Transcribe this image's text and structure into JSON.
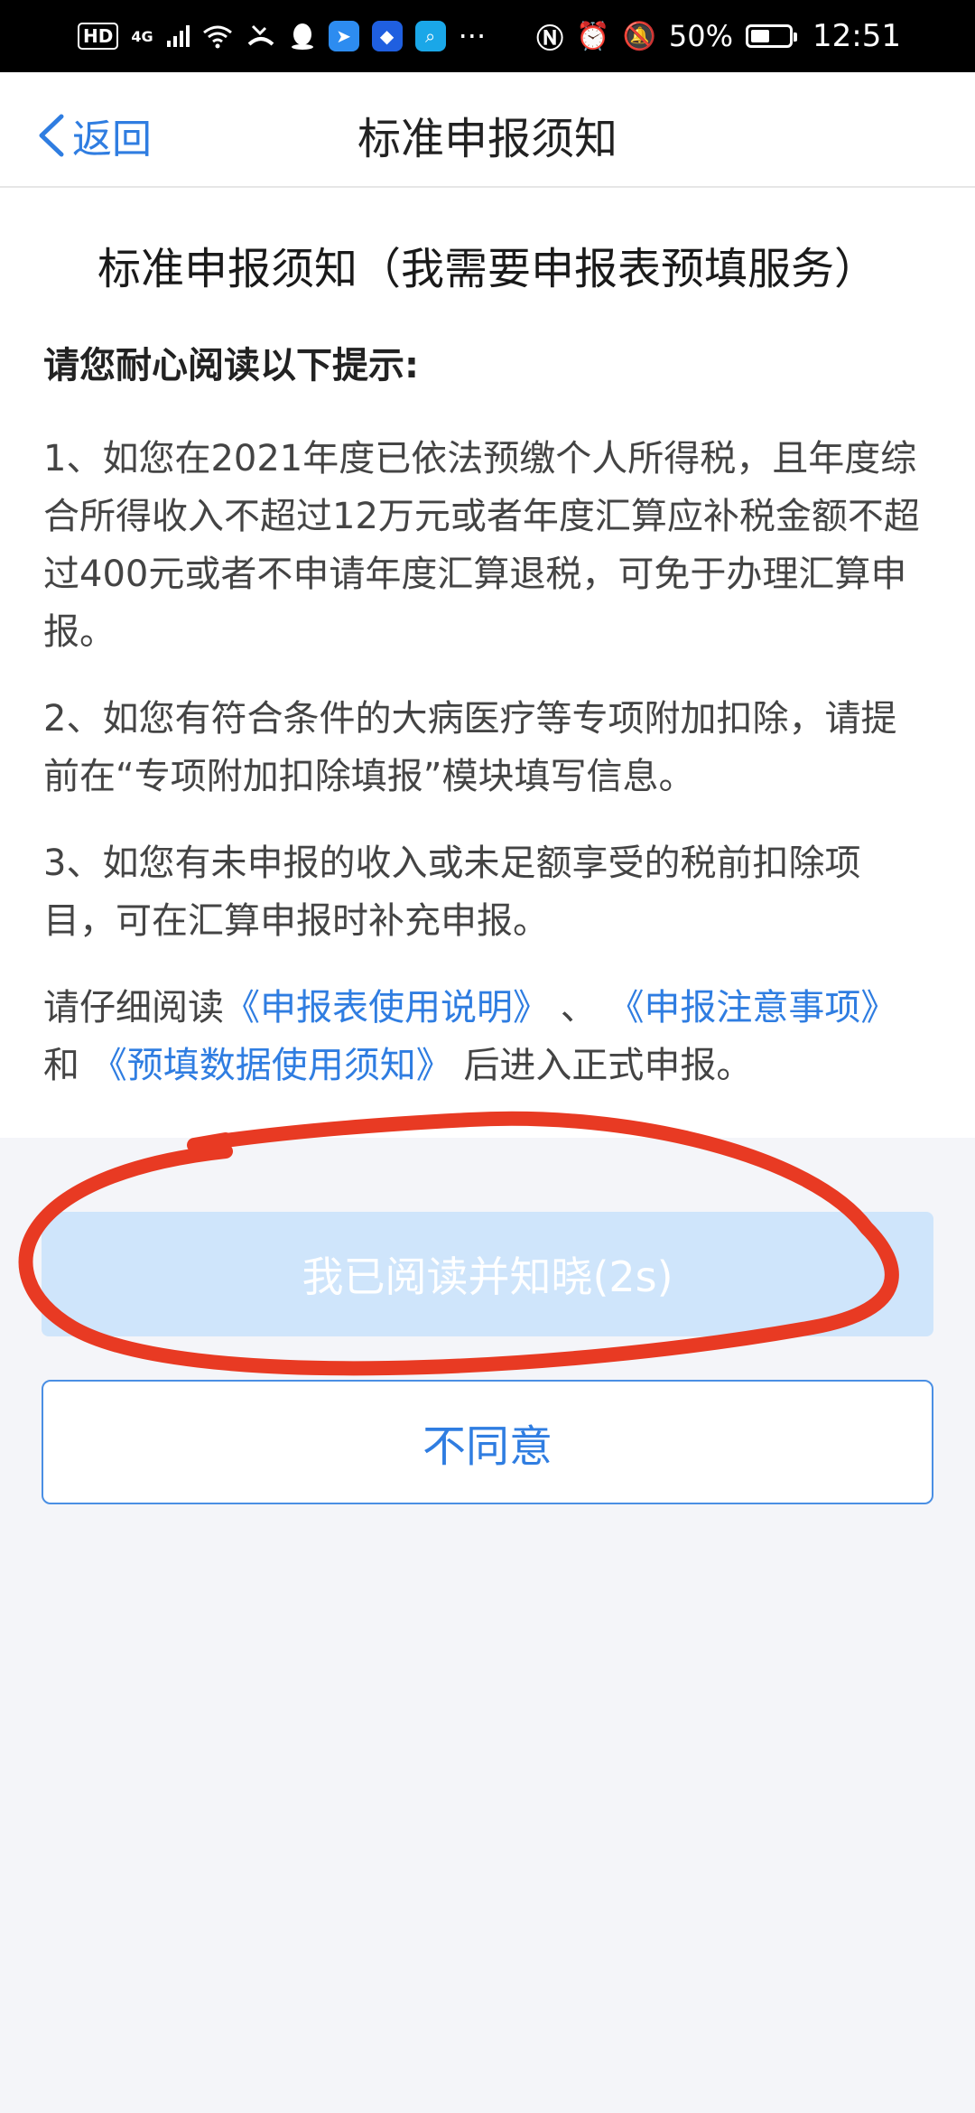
{
  "status_bar": {
    "hd_badge": "HD",
    "network": "4G",
    "battery_percent": "50%",
    "time": "12:51",
    "more": "···"
  },
  "nav": {
    "back_label": "返回",
    "title": "标准申报须知"
  },
  "content": {
    "title": "标准申报须知（我需要申报表预填服务）",
    "tip_heading": "请您耐心阅读以下提示:",
    "items": [
      "1、如您在2021年度已依法预缴个人所得税，且年度综合所得收入不超过12万元或者年度汇算应补税金额不超过400元或者不申请年度汇算退税，可免于办理汇算申报。",
      "2、如您有符合条件的大病医疗等专项附加扣除，请提前在“专项附加扣除填报”模块填写信息。",
      "3、如您有未申报的收入或未足额享受的税前扣除项目，可在汇算申报时补充申报。"
    ],
    "read_prompt": {
      "prefix": "请仔细阅读",
      "link1": "《申报表使用说明》",
      "sep1": "、",
      "link2": "《申报注意事项》",
      "sep2": "和",
      "link3": "《预填数据使用须知》",
      "suffix": "后进入正式申报。"
    }
  },
  "buttons": {
    "agree": "我已阅读并知晓(2s)",
    "disagree": "不同意"
  },
  "colors": {
    "accent": "#2f7de1",
    "disabled_button": "#cfe5fb",
    "annotation": "#e83a23"
  }
}
